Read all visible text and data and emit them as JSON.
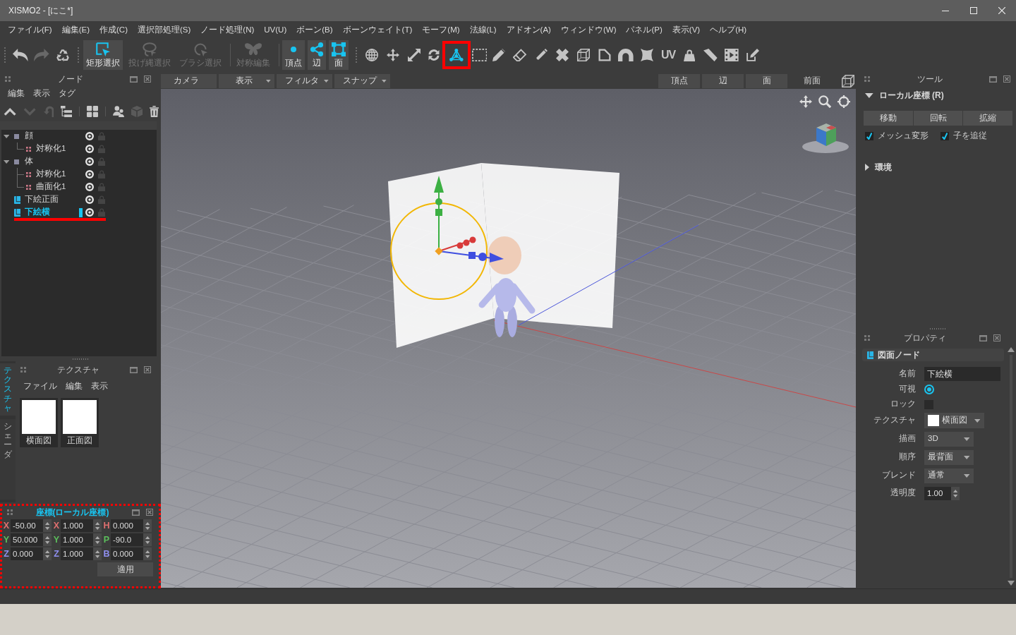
{
  "window": {
    "title": "XISMO2 - [にこ*]"
  },
  "menu": [
    "ファイル(F)",
    "編集(E)",
    "作成(C)",
    "選択部処理(S)",
    "ノード処理(N)",
    "UV(U)",
    "ボーン(B)",
    "ボーンウェイト(T)",
    "モーフ(M)",
    "法線(L)",
    "アドオン(A)",
    "ウィンドウ(W)",
    "パネル(P)",
    "表示(V)",
    "ヘルプ(H)"
  ],
  "toolbar": {
    "groups": [
      {
        "kind": "grip",
        "tools": [
          {
            "kind": "undo",
            "selected": false,
            "disabled": false,
            "highlighted": false
          },
          {
            "kind": "redo",
            "selected": false,
            "disabled": true,
            "highlighted": false
          },
          {
            "kind": "recycle",
            "selected": false,
            "disabled": false,
            "highlighted": false
          }
        ]
      },
      {
        "kind": "grip",
        "tools": [
          {
            "kind": "square-cursor",
            "label": "矩形選択",
            "selected": true,
            "disabled": false,
            "highlighted": false
          },
          {
            "kind": "lasso",
            "label": "投げ縄選択",
            "selected": false,
            "disabled": true,
            "highlighted": false
          },
          {
            "kind": "circle-cursor",
            "label": "ブラシ選択",
            "selected": false,
            "disabled": true,
            "highlighted": false
          }
        ]
      },
      {
        "kind": "line",
        "tools": [
          {
            "kind": "butterfly",
            "label": "対称編集",
            "selected": false,
            "disabled": true,
            "highlighted": false
          }
        ]
      },
      {
        "kind": "line",
        "tools": [
          {
            "kind": "dot",
            "label": "頂点",
            "selected": true,
            "disabled": false,
            "highlighted": false
          },
          {
            "kind": "connected-dots",
            "label": "辺",
            "selected": true,
            "disabled": false,
            "highlighted": false
          },
          {
            "kind": "square-corners",
            "label": "面",
            "selected": true,
            "disabled": false,
            "highlighted": false
          }
        ]
      },
      {
        "kind": "grip",
        "tools": [
          {
            "kind": "globe",
            "selected": false,
            "disabled": false,
            "highlighted": false
          },
          {
            "kind": "move-arrows",
            "selected": false,
            "disabled": false,
            "highlighted": false
          },
          {
            "kind": "diagonal-arrows",
            "selected": false,
            "disabled": false,
            "highlighted": false
          },
          {
            "kind": "rotate-arrows",
            "selected": false,
            "disabled": false,
            "highlighted": false
          },
          {
            "kind": "axis-gizmo",
            "selected": true,
            "disabled": false,
            "highlighted": true
          },
          {
            "kind": "dashed-rectangle",
            "selected": false,
            "disabled": false,
            "highlighted": false
          },
          {
            "kind": "pencil",
            "selected": false,
            "disabled": false,
            "highlighted": false
          },
          {
            "kind": "eraser",
            "selected": false,
            "disabled": false,
            "highlighted": false
          },
          {
            "kind": "marker",
            "selected": false,
            "disabled": false,
            "highlighted": false
          },
          {
            "kind": "bandage",
            "selected": false,
            "disabled": false,
            "highlighted": false
          },
          {
            "kind": "wire-cube",
            "selected": false,
            "disabled": false,
            "highlighted": false
          },
          {
            "kind": "polygon",
            "selected": false,
            "disabled": false,
            "highlighted": false
          },
          {
            "kind": "magnet",
            "selected": false,
            "disabled": false,
            "highlighted": false
          },
          {
            "kind": "pinched-square",
            "selected": false,
            "disabled": false,
            "highlighted": false
          },
          {
            "kind": "text",
            "text": "UV",
            "selected": false,
            "disabled": false,
            "highlighted": false
          },
          {
            "kind": "weight",
            "selected": false,
            "disabled": false,
            "highlighted": false
          },
          {
            "kind": "blade",
            "selected": false,
            "disabled": false,
            "highlighted": false
          },
          {
            "kind": "film",
            "selected": false,
            "disabled": false,
            "highlighted": false
          },
          {
            "kind": "edit-box",
            "selected": false,
            "disabled": false,
            "highlighted": false
          }
        ]
      }
    ]
  },
  "node_panel": {
    "title": "ノード",
    "menu": [
      "編集",
      "表示",
      "タグ"
    ],
    "tool_groups": [
      [
        {
          "kind": "chevron-up",
          "disabled": false
        },
        {
          "kind": "chevron-down",
          "disabled": true
        },
        {
          "kind": "undo-arrow",
          "disabled": true
        },
        {
          "kind": "list-tree",
          "disabled": false
        }
      ],
      [
        {
          "kind": "grid",
          "disabled": false
        }
      ],
      [
        {
          "kind": "people",
          "disabled": false
        },
        {
          "kind": "cube",
          "disabled": true
        },
        {
          "kind": "trash",
          "disabled": false
        }
      ]
    ],
    "nodes": [
      {
        "name": "顔",
        "kind": "group",
        "expanded": true,
        "visible": true,
        "locked": false,
        "selected": false,
        "highlighted": false,
        "children": [
          {
            "name": "対称化1",
            "kind": "modifier",
            "visible": true,
            "locked": false,
            "selected": false,
            "highlighted": false
          }
        ]
      },
      {
        "name": "体",
        "kind": "group",
        "expanded": true,
        "visible": true,
        "locked": false,
        "selected": false,
        "highlighted": false,
        "children": [
          {
            "name": "対称化1",
            "kind": "modifier",
            "visible": true,
            "locked": false,
            "selected": false,
            "highlighted": false
          },
          {
            "name": "曲面化1",
            "kind": "modifier",
            "visible": true,
            "locked": false,
            "selected": false,
            "highlighted": false
          }
        ]
      },
      {
        "name": "下絵正面",
        "kind": "image",
        "visible": true,
        "locked": false,
        "selected": false,
        "highlighted": false
      },
      {
        "name": "下絵横",
        "kind": "image",
        "visible": true,
        "locked": false,
        "selected": true,
        "highlighted": true
      }
    ]
  },
  "texture_panel": {
    "title": "テクスチャ",
    "side_tabs": [
      {
        "label": "テクスチャ",
        "selected": true
      },
      {
        "label": "シェーダ",
        "selected": false
      }
    ],
    "menu": [
      "ファイル",
      "編集",
      "表示"
    ],
    "textures": [
      {
        "name": "横面図"
      },
      {
        "name": "正面図"
      }
    ]
  },
  "coordinates": {
    "title": "座標(ローカル座標)",
    "active": true,
    "highlighted": true,
    "rows": [
      [
        {
          "axis": "X",
          "color": "#e07070",
          "value": "-50.00"
        },
        {
          "axis": "X",
          "color": "#e07070",
          "value": "1.000"
        },
        {
          "axis": "H",
          "color": "#e07070",
          "value": "0.000"
        }
      ],
      [
        {
          "axis": "Y",
          "color": "#5cbf5c",
          "value": "50.000"
        },
        {
          "axis": "Y",
          "color": "#5cbf5c",
          "value": "1.000"
        },
        {
          "axis": "P",
          "color": "#5cbf5c",
          "value": "-90.0"
        }
      ],
      [
        {
          "axis": "Z",
          "color": "#9090f0",
          "value": "0.000"
        },
        {
          "axis": "Z",
          "color": "#9090f0",
          "value": "1.000"
        },
        {
          "axis": "B",
          "color": "#9090f0",
          "value": "0.000"
        }
      ]
    ],
    "apply": "適用"
  },
  "viewport": {
    "menus": [
      {
        "label": "カメラ",
        "caret": false
      },
      {
        "label": "表示",
        "caret": true
      },
      {
        "label": "フィルタ",
        "caret": true
      },
      {
        "label": "スナップ",
        "caret": true
      }
    ],
    "modes": [
      "頂点",
      "辺",
      "面"
    ],
    "view_name": "前面"
  },
  "tool_panel": {
    "title": "ツール",
    "sections": [
      {
        "title": "ローカル座標 (R)",
        "expanded": true,
        "buttons": [
          "移動",
          "回転",
          "拡縮"
        ],
        "checkboxes": [
          {
            "label": "メッシュ変形",
            "checked": true
          },
          {
            "label": "子を追従",
            "checked": true
          }
        ]
      },
      {
        "title": "環境",
        "expanded": false
      }
    ]
  },
  "property_panel": {
    "title": "プロパティ",
    "section": "図面ノード",
    "rows": [
      {
        "kind": "text",
        "label": "名前",
        "value": "下絵横"
      },
      {
        "kind": "radio",
        "label": "可視",
        "on": true
      },
      {
        "kind": "checkbox",
        "label": "ロック",
        "checked": false
      },
      {
        "kind": "texture",
        "label": "テクスチャ",
        "value": "横面図"
      },
      {
        "kind": "select",
        "label": "描画",
        "value": "3D"
      },
      {
        "kind": "select",
        "label": "順序",
        "value": "最背面"
      },
      {
        "kind": "select",
        "label": "ブレンド",
        "value": "通常"
      },
      {
        "kind": "spin",
        "label": "透明度",
        "value": "1.00"
      }
    ]
  }
}
